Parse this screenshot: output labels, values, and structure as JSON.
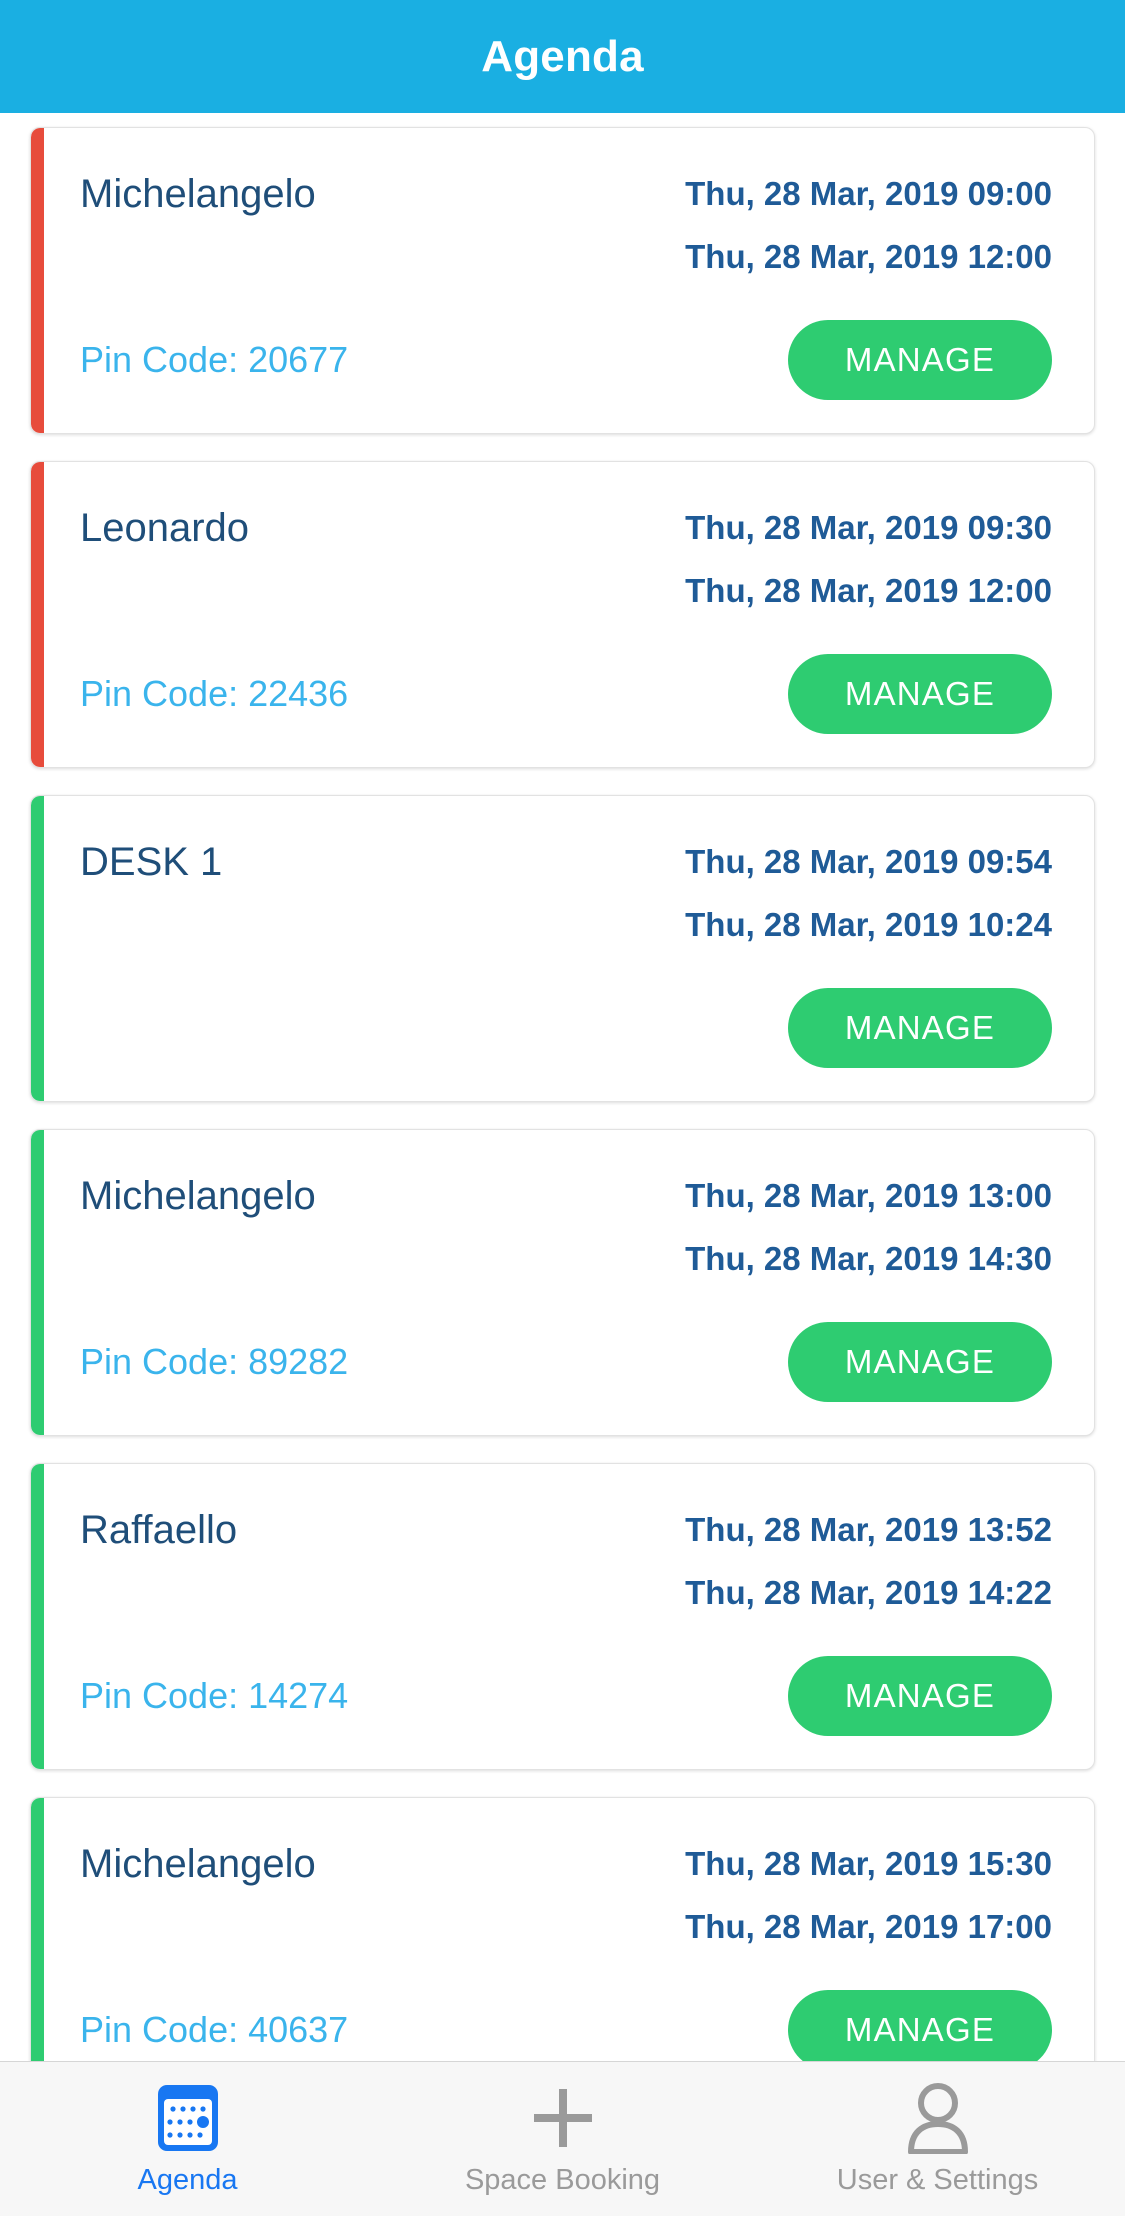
{
  "header": {
    "title": "Agenda",
    "background_color": "#1AAFE2",
    "text_color": "#FFFFFF"
  },
  "colors": {
    "accent_red": "#E74C3C",
    "accent_green": "#2ECC71",
    "button_green": "#2ECC71",
    "title_navy": "#1F4E79",
    "date_blue": "#1F5B97",
    "pin_blue": "#3AB4EC",
    "tab_active": "#1877F2",
    "tab_inactive": "#9A9A9A"
  },
  "manage_button_label": "MANAGE",
  "cards": [
    {
      "title": "Michelangelo",
      "start": "Thu, 28 Mar, 2019 09:00",
      "end": "Thu, 28 Mar, 2019 12:00",
      "pin": "Pin Code: 20677",
      "status_color": "red",
      "action": "MANAGE"
    },
    {
      "title": "Leonardo",
      "start": "Thu, 28 Mar, 2019 09:30",
      "end": "Thu, 28 Mar, 2019 12:00",
      "pin": "Pin Code: 22436",
      "status_color": "red",
      "action": "MANAGE"
    },
    {
      "title": "DESK 1",
      "start": "Thu, 28 Mar, 2019 09:54",
      "end": "Thu, 28 Mar, 2019 10:24",
      "pin": "",
      "status_color": "green",
      "action": "MANAGE"
    },
    {
      "title": "Michelangelo",
      "start": "Thu, 28 Mar, 2019 13:00",
      "end": "Thu, 28 Mar, 2019 14:30",
      "pin": "Pin Code: 89282",
      "status_color": "green",
      "action": "MANAGE"
    },
    {
      "title": "Raffaello",
      "start": "Thu, 28 Mar, 2019 13:52",
      "end": "Thu, 28 Mar, 2019 14:22",
      "pin": "Pin Code: 14274",
      "status_color": "green",
      "action": "MANAGE"
    },
    {
      "title": "Michelangelo",
      "start": "Thu, 28 Mar, 2019 15:30",
      "end": "Thu, 28 Mar, 2019 17:00",
      "pin": "Pin Code: 40637",
      "status_color": "green",
      "action": "MANAGE"
    }
  ],
  "tabbar": {
    "items": [
      {
        "label": "Agenda",
        "icon": "calendar-icon",
        "active": true
      },
      {
        "label": "Space Booking",
        "icon": "plus-icon",
        "active": false
      },
      {
        "label": "User & Settings",
        "icon": "person-icon",
        "active": false
      }
    ]
  }
}
